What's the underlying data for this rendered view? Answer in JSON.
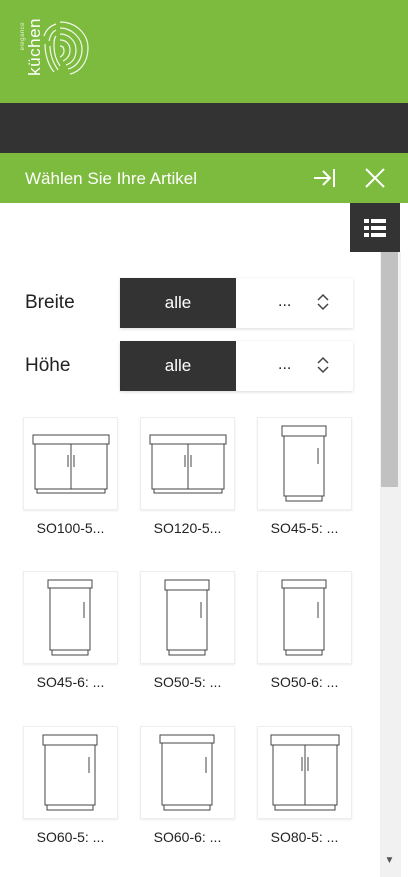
{
  "brand": {
    "word": "küchen",
    "small": "elegance"
  },
  "panel": {
    "title": "Wählen Sie Ihre Artikel"
  },
  "filters": [
    {
      "label": "Breite",
      "selected": "alle",
      "other": "..."
    },
    {
      "label": "Höhe",
      "selected": "alle",
      "other": "..."
    }
  ],
  "items": [
    {
      "label": "SO100-5..."
    },
    {
      "label": "SO120-5..."
    },
    {
      "label": "SO45-5: ..."
    },
    {
      "label": "SO45-6: ..."
    },
    {
      "label": "SO50-5: ..."
    },
    {
      "label": "SO50-6: ..."
    },
    {
      "label": "SO60-5: ..."
    },
    {
      "label": "SO60-6: ..."
    },
    {
      "label": "SO80-5: ..."
    }
  ],
  "colors": {
    "green": "#7dbb3f",
    "dark": "#333333"
  },
  "icons": [
    "fingerprint-logo-icon",
    "collapse-panel-icon",
    "close-icon",
    "list-view-icon",
    "chevron-updown-icon"
  ]
}
